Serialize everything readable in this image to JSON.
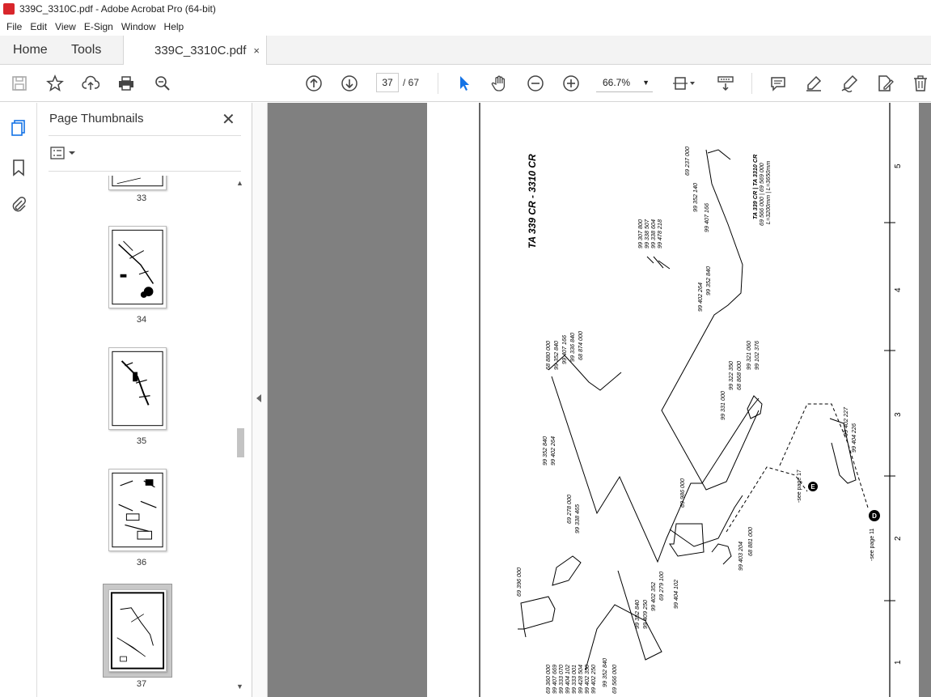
{
  "window": {
    "title": "339C_3310C.pdf - Adobe Acrobat Pro (64-bit)"
  },
  "menu": [
    "File",
    "Edit",
    "View",
    "E-Sign",
    "Window",
    "Help"
  ],
  "tabs": {
    "home": "Home",
    "tools": "Tools",
    "document": "339C_3310C.pdf",
    "close": "×"
  },
  "toolbar": {
    "current_page": "37",
    "page_total": "/ 67",
    "zoom": "66.7%"
  },
  "panel": {
    "title": "Page Thumbnails",
    "close": "✕",
    "thumbnails": [
      {
        "label": "33"
      },
      {
        "label": "34"
      },
      {
        "label": "35"
      },
      {
        "label": "36"
      },
      {
        "label": "37",
        "selected": true
      }
    ]
  },
  "document_page": {
    "heading": "TA 339 CR - 3310 CR",
    "row_numbers": [
      "5",
      "4",
      "3",
      "2",
      "1"
    ],
    "callouts": [
      "69 237 000",
      "99 352 140",
      "99 407 166",
      "TA 339 CR | TA 3310 CR",
      "69 566 000 | 69 569 000",
      "L=3200mm | L=3650mm",
      "99 307 800",
      "99 338 507",
      "99 338 604",
      "99 478 218",
      "99 402 264",
      "99 352 840",
      "68 880 000",
      "99 352 840",
      "99 407 166",
      "99 336 840",
      "68 874 000",
      "99 321 060",
      "99 102 376",
      "99 322 350",
      "68 868 000",
      "99 331 000",
      "99 352 840",
      "99 402 264",
      "99 402 227",
      "99 404 226",
      "69 986 000",
      "69 278 000",
      "99 338 465",
      "69 396 000",
      "99 403 204",
      "68 881 000",
      "99 352 840",
      "99 409 250",
      "99 402 352",
      "69 279 100",
      "99 404 102",
      "69 360 000",
      "99 407 669",
      "99 333 070",
      "99 404 102",
      "99 333 001",
      "99 428 504",
      "99 402 350",
      "99 402 250",
      "99 352 840",
      "69 566 000"
    ],
    "markers": [
      {
        "letter": "E",
        "note": "-see page 17"
      },
      {
        "letter": "D",
        "note": "-see page 11"
      }
    ]
  }
}
